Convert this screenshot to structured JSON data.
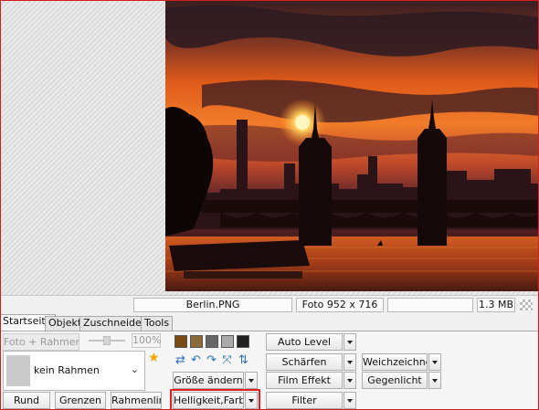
{
  "status": {
    "filename": "Berlin.PNG",
    "dimensions": "Foto 952 x 716",
    "empty_field": "",
    "filesize": "1.3 MB"
  },
  "tabs": [
    "Startseite",
    "Objekt",
    "Zuschneiden",
    "Tools"
  ],
  "left_panel": {
    "photo_frame_button": "Foto + Rahmen",
    "zoom_value": "100%",
    "frame_select_value": "kein Rahmen",
    "round_button": "Rund",
    "borders_button": "Grenzen",
    "frame_line_button": "Rahmenlinie"
  },
  "tools": {
    "resize_button": "Größe ändern",
    "brightness_color_button": "Helligkeit,Farbe",
    "auto_level_button": "Auto Level",
    "sharpen_button": "Schärfen",
    "film_effect_button": "Film Effekt",
    "filter_button": "Filter",
    "soften_button": "Weichzeichnen",
    "backlight_button": "Gegenlicht"
  },
  "tone_swatches": [
    "#7a4a14",
    "#8a6a3a",
    "#666666",
    "#aaaaaa",
    "#202020"
  ],
  "colors": {
    "highlight": "#e02020",
    "star": "#f0a800"
  }
}
